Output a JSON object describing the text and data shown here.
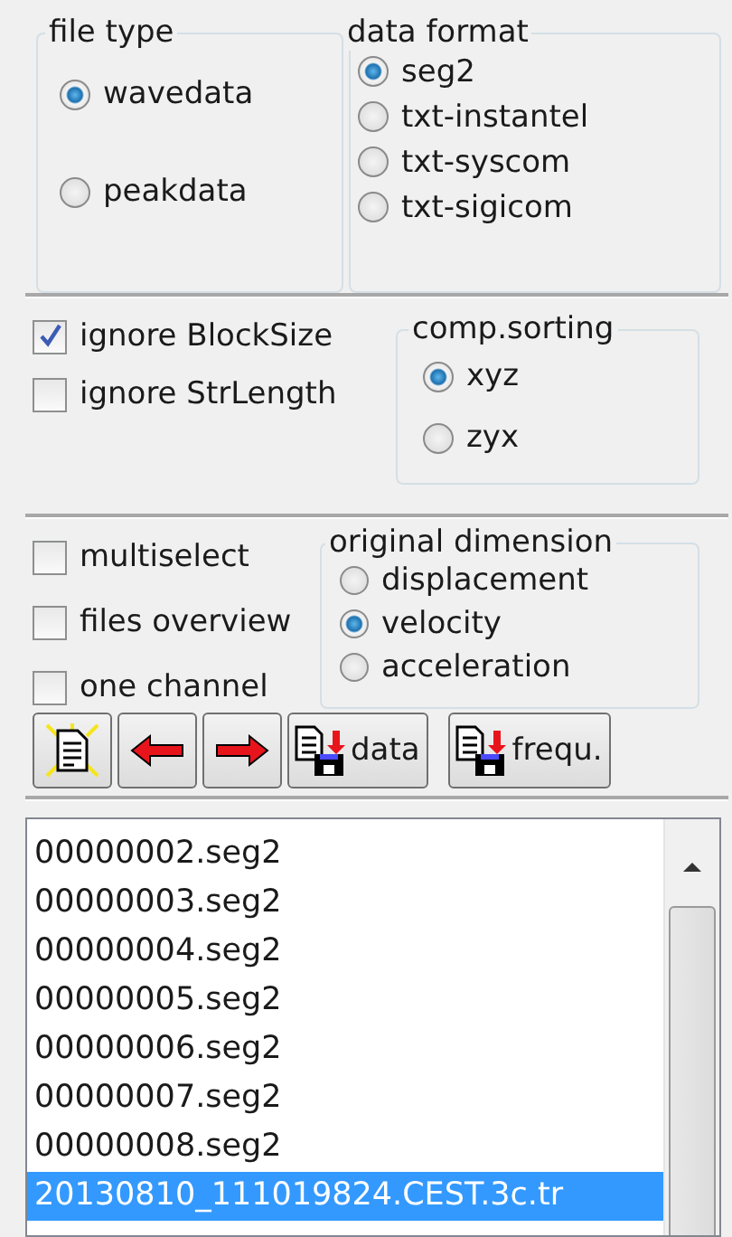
{
  "file_type": {
    "title": "file type",
    "options": [
      {
        "label": "wavedata",
        "selected": true
      },
      {
        "label": "peakdata",
        "selected": false
      }
    ]
  },
  "data_format": {
    "title": "data format",
    "options": [
      {
        "label": "seg2",
        "selected": true
      },
      {
        "label": "txt-instantel",
        "selected": false
      },
      {
        "label": "txt-syscom",
        "selected": false
      },
      {
        "label": "txt-sigicom",
        "selected": false
      }
    ]
  },
  "ignore_options": [
    {
      "label": "ignore BlockSize",
      "checked": true
    },
    {
      "label": "ignore StrLength",
      "checked": false
    }
  ],
  "comp_sorting": {
    "title": "comp.sorting",
    "options": [
      {
        "label": "xyz",
        "selected": true
      },
      {
        "label": "zyx",
        "selected": false
      }
    ]
  },
  "view_options": [
    {
      "label": "multiselect",
      "checked": false
    },
    {
      "label": "files overview",
      "checked": false
    },
    {
      "label": "one channel",
      "checked": false
    }
  ],
  "original_dimension": {
    "title": "original dimension",
    "options": [
      {
        "label": "displacement",
        "selected": false
      },
      {
        "label": "velocity",
        "selected": true
      },
      {
        "label": "acceleration",
        "selected": false
      }
    ]
  },
  "toolbar": [
    {
      "kind": "new"
    },
    {
      "kind": "back"
    },
    {
      "kind": "forward"
    },
    {
      "kind": "save",
      "label": "data"
    },
    {
      "kind": "save",
      "label": "frequ."
    }
  ],
  "file_list": [
    {
      "name": "00000002.seg2",
      "selected": false
    },
    {
      "name": "00000003.seg2",
      "selected": false
    },
    {
      "name": "00000004.seg2",
      "selected": false
    },
    {
      "name": "00000005.seg2",
      "selected": false
    },
    {
      "name": "00000006.seg2",
      "selected": false
    },
    {
      "name": "00000007.seg2",
      "selected": false
    },
    {
      "name": "00000008.seg2",
      "selected": false
    },
    {
      "name": "20130810_111019824.CEST.3c.tr",
      "selected": true
    }
  ]
}
